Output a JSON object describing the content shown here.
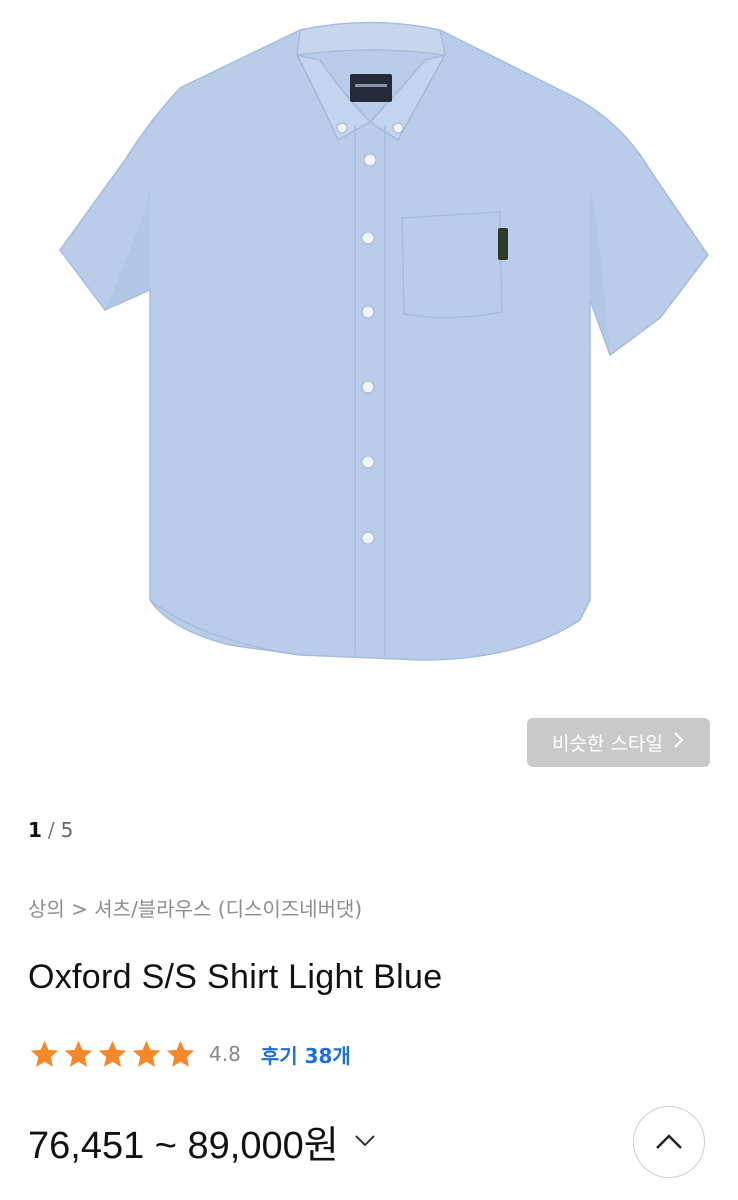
{
  "gallery": {
    "current_page": "1",
    "page_separator": "/",
    "total_pages": "5",
    "shirt_color": "#b9cdea"
  },
  "similar_style_button": {
    "label": "비슷한 스타일",
    "icon": "chevron-right-icon"
  },
  "product": {
    "breadcrumb": "상의 > 셔츠/블라우스 (디스이즈네버댓)",
    "title": "Oxford S/S Shirt Light Blue",
    "rating": {
      "value": 4.8,
      "value_text": "4.8",
      "max_stars": 5,
      "reviews_label": "후기 38개"
    },
    "price": {
      "text": "76,451 ~ 89,000원",
      "toggle_icon": "chevron-down-icon"
    }
  },
  "scroll_top_button": {
    "icon": "chevron-up-icon"
  },
  "colors": {
    "star": "#f5882a",
    "review_link": "#1d6fd8",
    "muted_text": "#8d8d8d",
    "similar_button_bg": "#c9c9c9"
  }
}
